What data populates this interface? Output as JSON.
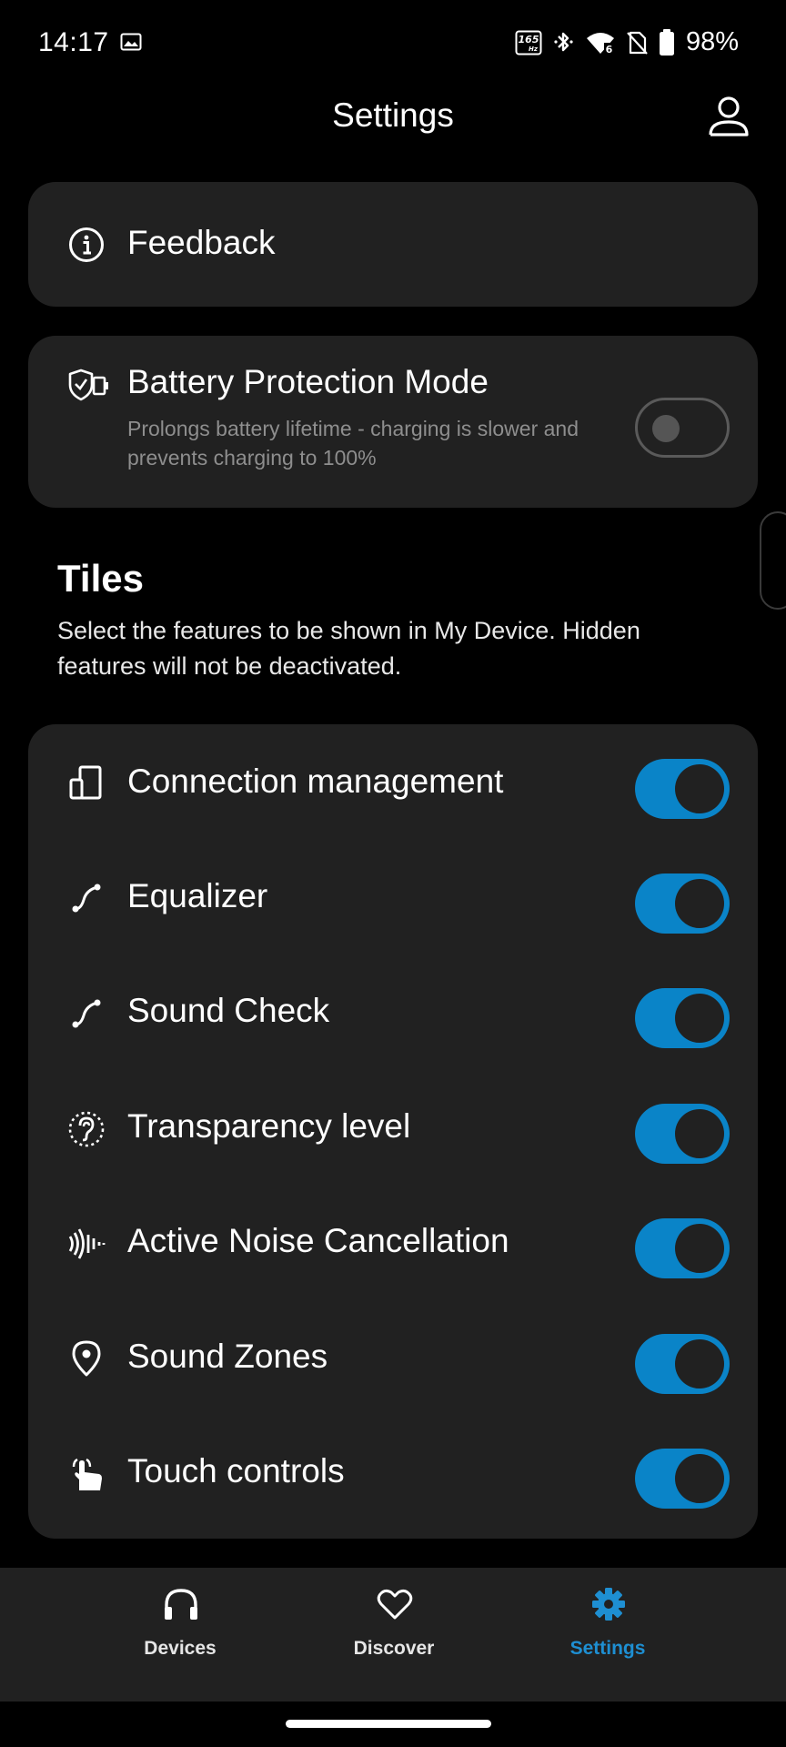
{
  "status_bar": {
    "time": "14:17",
    "refresh_rate": "165",
    "refresh_unit": "Hz",
    "battery_percent": "98%"
  },
  "header": {
    "title": "Settings"
  },
  "feedback": {
    "label": "Feedback"
  },
  "battery_protection": {
    "label": "Battery Protection Mode",
    "description": "Prolongs battery lifetime - charging is slower and prevents charging to 100%",
    "enabled": false
  },
  "tiles": {
    "title": "Tiles",
    "description": "Select the features to be shown in My Device. Hidden features will not be deactivated.",
    "items": [
      {
        "label": "Connection management",
        "icon": "devices-icon",
        "enabled": true
      },
      {
        "label": "Equalizer",
        "icon": "curve-icon",
        "enabled": true
      },
      {
        "label": "Sound Check",
        "icon": "curve-icon",
        "enabled": true
      },
      {
        "label": "Transparency level",
        "icon": "ear-icon",
        "enabled": true
      },
      {
        "label": "Active Noise Cancellation",
        "icon": "noise-wave-icon",
        "enabled": true
      },
      {
        "label": "Sound Zones",
        "icon": "location-pin-icon",
        "enabled": true
      },
      {
        "label": "Touch controls",
        "icon": "touch-hand-icon",
        "enabled": true
      }
    ]
  },
  "bottom_nav": {
    "items": [
      {
        "label": "Devices",
        "icon": "headphones-icon",
        "active": false
      },
      {
        "label": "Discover",
        "icon": "heart-icon",
        "active": false
      },
      {
        "label": "Settings",
        "icon": "gear-icon",
        "active": true
      }
    ]
  },
  "colors": {
    "accent": "#0a84c8",
    "nav_active": "#1e8fd2",
    "card_bg": "#212121",
    "background": "#000000"
  }
}
